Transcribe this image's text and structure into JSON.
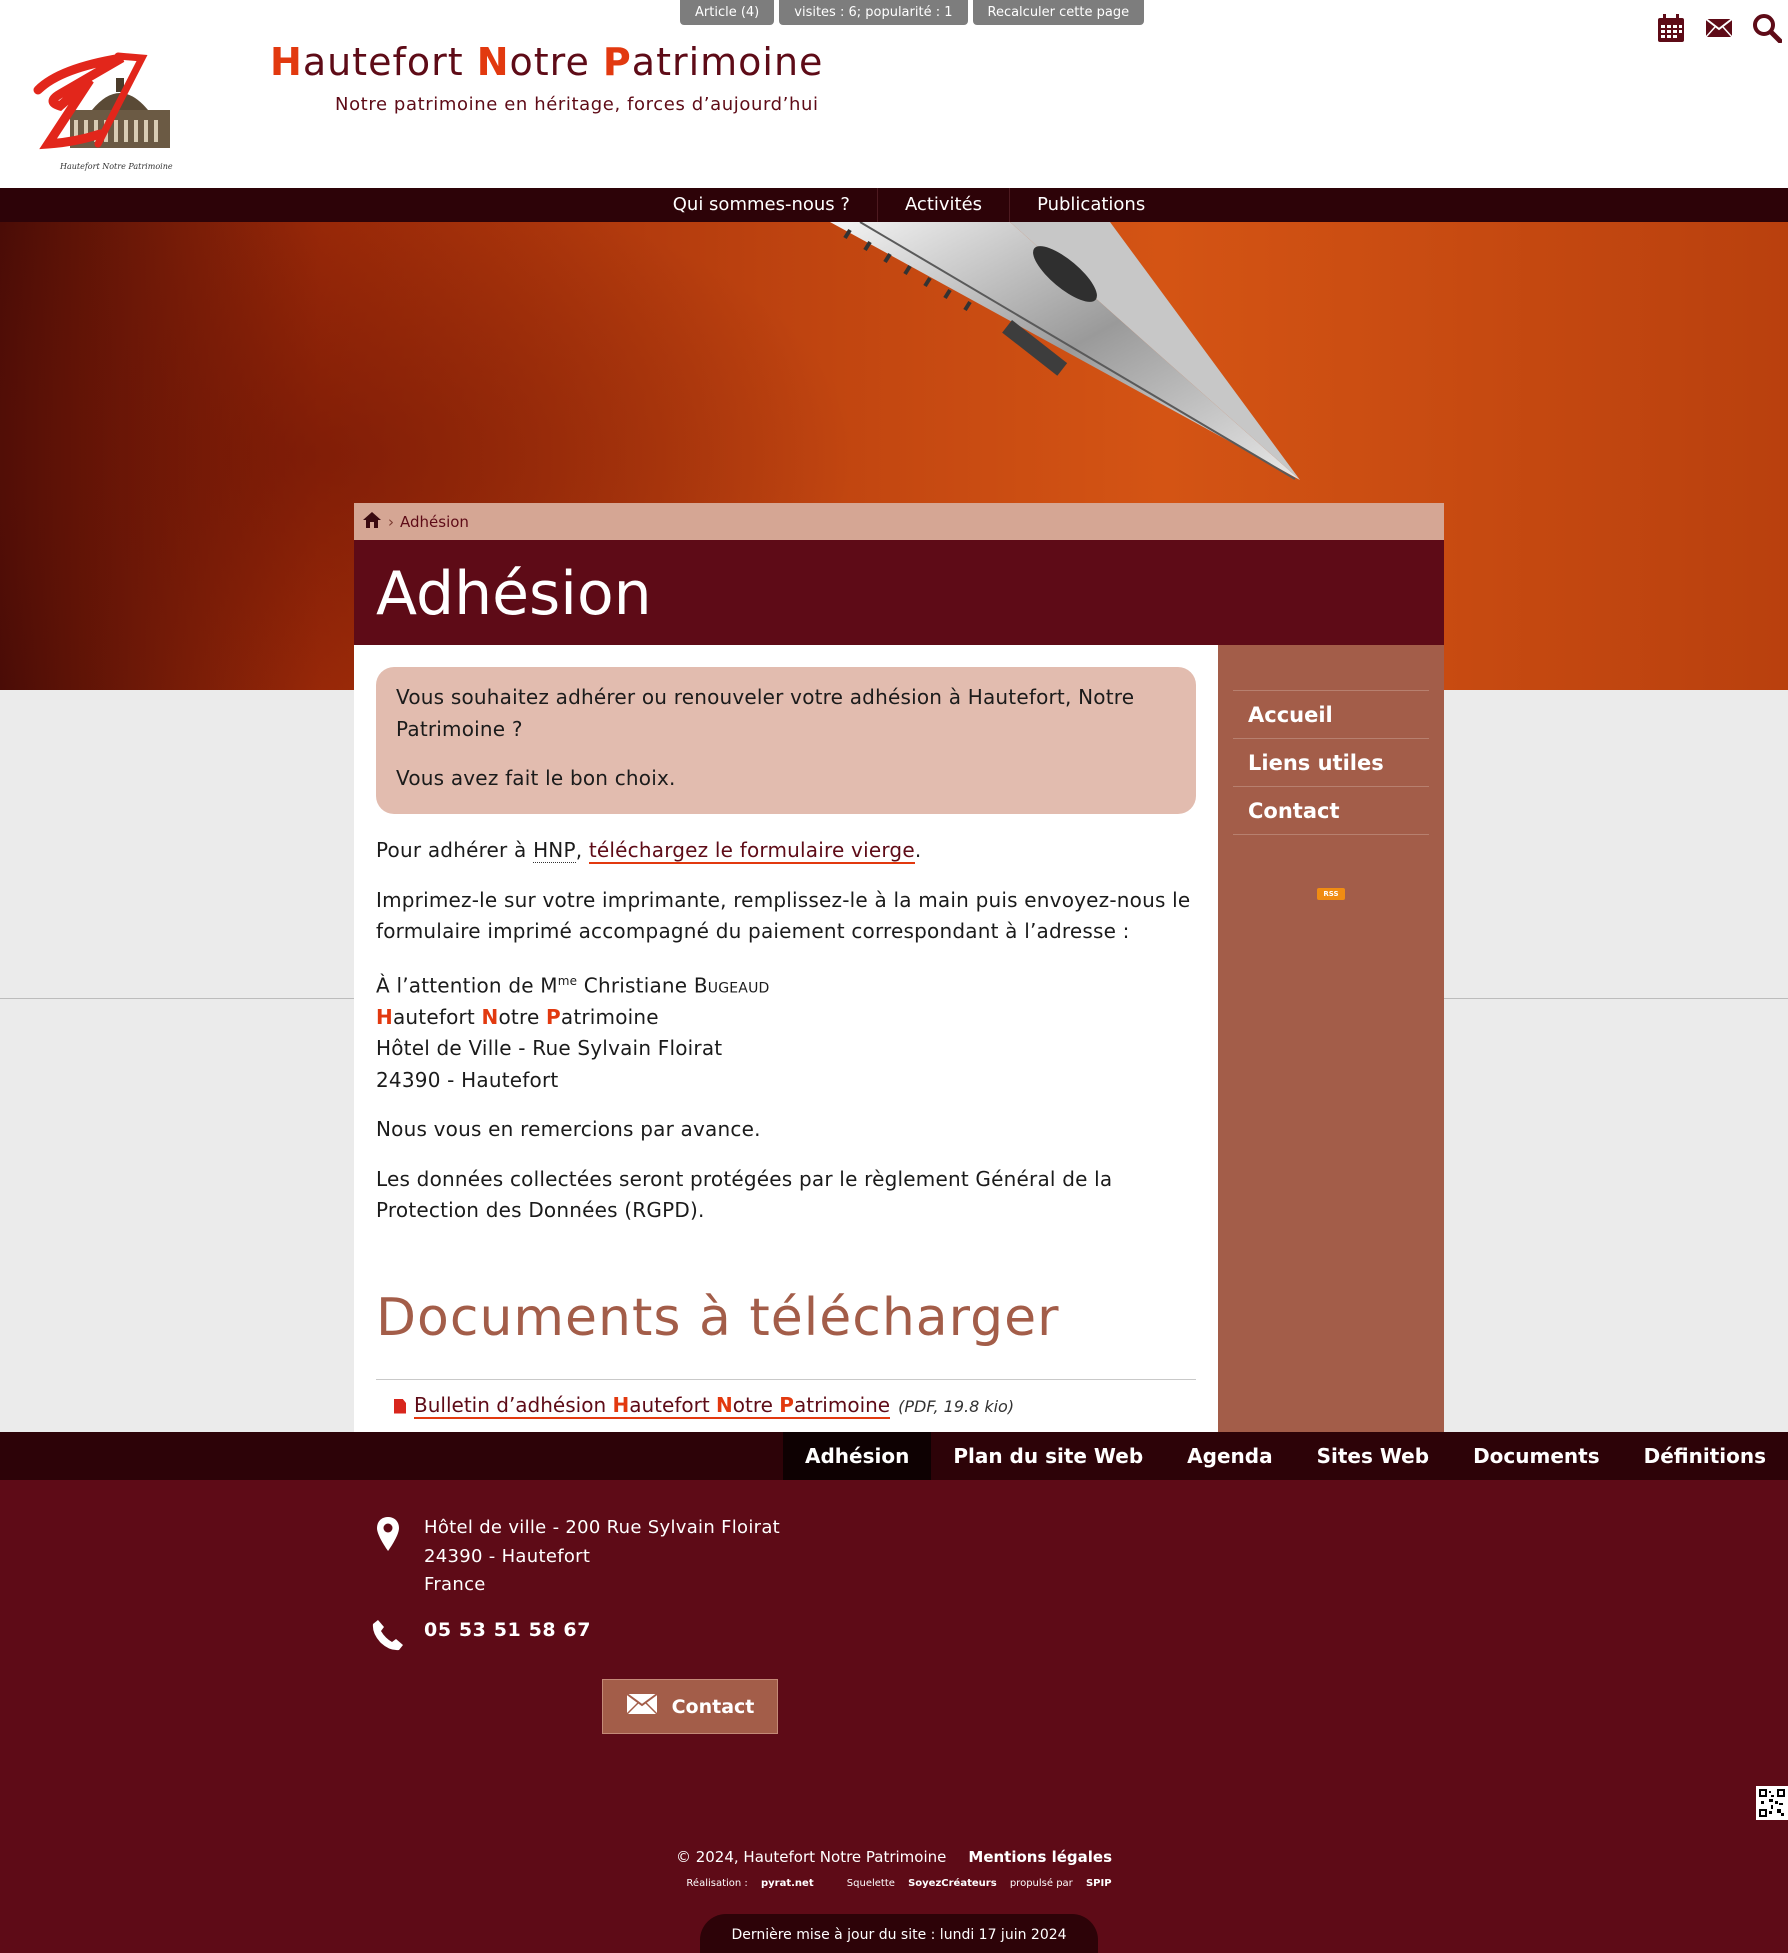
{
  "admin_bar": {
    "article": "Article (4)",
    "visits": "visites : 6; popularité : 1",
    "recalc": "Recalculer cette page"
  },
  "header": {
    "title_parts": [
      {
        "initial": "H",
        "rest": "autefort "
      },
      {
        "initial": "N",
        "rest": "otre "
      },
      {
        "initial": "P",
        "rest": "atrimoine"
      }
    ],
    "slogan": "Notre patrimoine en héritage, forces d’aujourd’hui",
    "logo_caption": "Hautefort Notre Patrimoine"
  },
  "icons": {
    "calendar": "calendar-icon",
    "mail": "mail-icon",
    "search": "search-icon"
  },
  "main_nav": [
    "Qui sommes-nous ?",
    "Activités",
    "Publications"
  ],
  "breadcrumb": {
    "current": "Adhésion"
  },
  "page_title": "Adhésion",
  "intro": {
    "line1": "Vous souhaitez adhérer ou renouveler votre adhésion à Hautefort, Notre Patrimoine ?",
    "line2": "Vous avez fait le bon choix."
  },
  "body": {
    "p1_prefix": "Pour adhérer à ",
    "p1_abbr": "HNP",
    "p1_sep": ", ",
    "p1_link": "téléchargez le formulaire vierge",
    "p1_suffix": ".",
    "p2": "Imprimez-le sur votre imprimante, remplissez-le à la main puis envoyez-nous le formulaire imprimé accompagné du paiement correspondant à l’adresse :",
    "address_attn_prefix": "À l’attention de M",
    "address_attn_sup": "me",
    "address_attn_first": " Christiane ",
    "address_attn_last": "Bugeaud",
    "address_street": "Hôtel de Ville - Rue Sylvain Floirat",
    "address_city": "24390 - Hautefort",
    "p4": "Nous vous en remercions par avance.",
    "p5": "Les données collectées seront protégées par le règlement Général de la Protection des Données (RGPD)."
  },
  "documents": {
    "title": "Documents à télécharger",
    "file_prefix": "Bulletin d’adhésion ",
    "file_meta": "(PDF, 19.8 kio)"
  },
  "sidebar": {
    "items": [
      "Accueil",
      "Liens utiles",
      "Contact"
    ],
    "rss": "RSS"
  },
  "footer_nav": {
    "items": [
      "Adhésion",
      "Plan du site Web",
      "Agenda",
      "Sites Web",
      "Documents",
      "Définitions"
    ],
    "active": "Adhésion"
  },
  "footer": {
    "address_lines": [
      "Hôtel de ville - 200 Rue Sylvain Floirat",
      "24390 - Hautefort",
      "France"
    ],
    "phone": "05 53 51 58 67",
    "contact_button": "Contact",
    "copyright": "© 2024, Hautefort Notre Patrimoine",
    "legal": "Mentions légales",
    "credit_prefix": "Réalisation : ",
    "credit_name": "pyrat.net",
    "skeleton_prefix": "Squelette ",
    "skeleton_name": "SoyezCréateurs",
    "skeleton_mid": " propulsé par ",
    "skeleton_spip": "SPIP",
    "last_update": "Dernière mise à jour du site : lundi 17 juin 2024"
  },
  "colors": {
    "brand_dark": "#5e0b17",
    "brand_accent": "#e2390f",
    "sidebar": "#a35d49",
    "nav_dark": "#2d0308"
  }
}
